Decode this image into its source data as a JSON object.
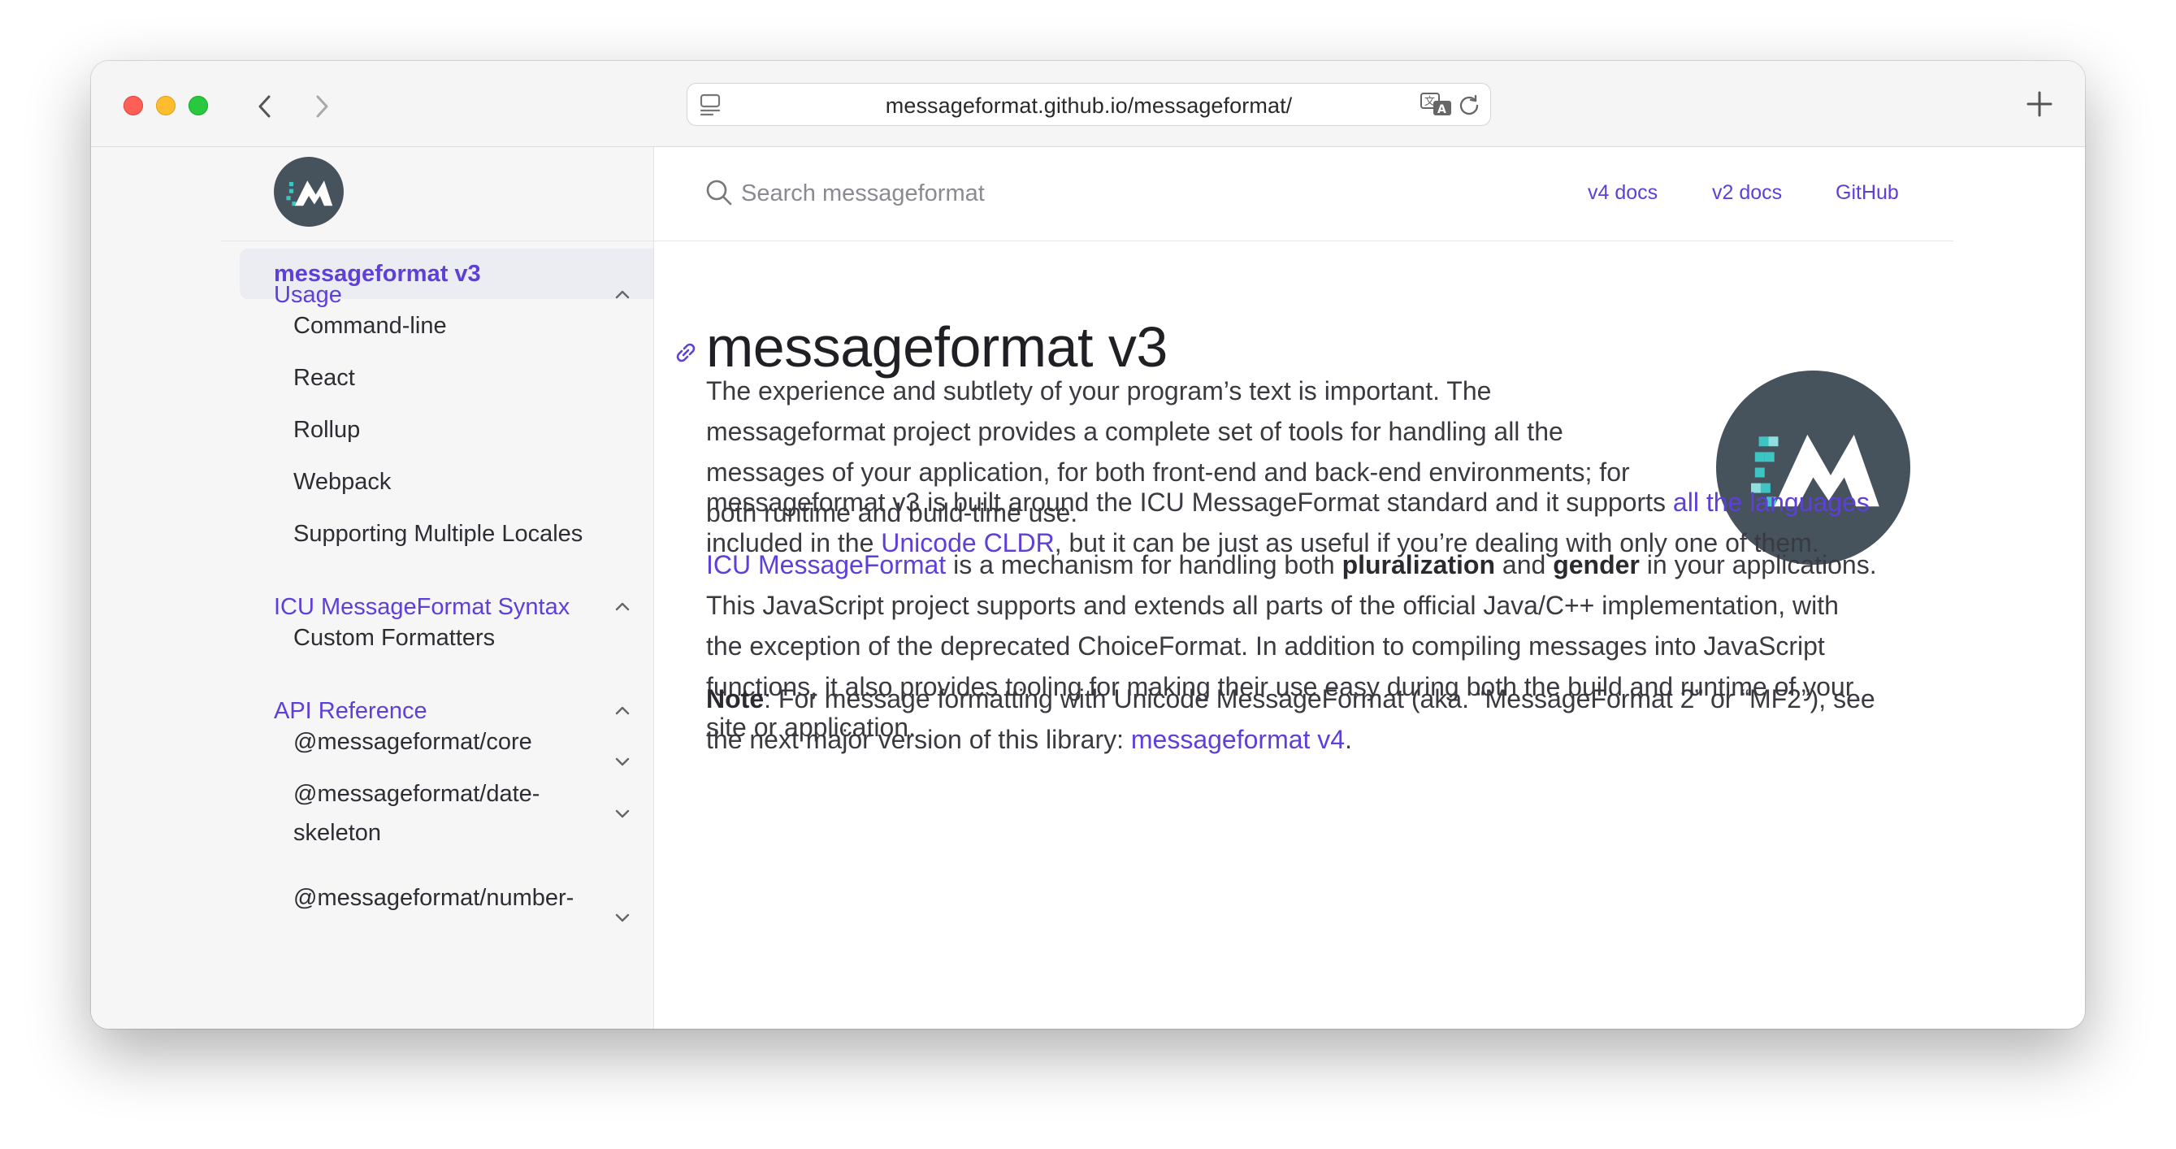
{
  "browser": {
    "url": "messageformat.github.io/messageformat/"
  },
  "header": {
    "search_placeholder": "Search messageformat",
    "links": [
      "v4 docs",
      "v2 docs",
      "GitHub"
    ]
  },
  "sidebar": {
    "active": "messageformat v3",
    "usage": {
      "label": "Usage",
      "items": [
        "Command-line",
        "React",
        "Rollup",
        "Webpack",
        "Supporting Multiple Locales"
      ]
    },
    "syntax": {
      "label": "ICU MessageFormat Syntax",
      "items": [
        "Custom Formatters"
      ]
    },
    "api": {
      "label": "API Reference",
      "items": [
        {
          "line1": "@messageformat/core",
          "line2": ""
        },
        {
          "line1": "@messageformat/date-",
          "line2": "skeleton"
        },
        {
          "line1": "@messageformat/number-",
          "line2": ""
        }
      ]
    }
  },
  "main": {
    "title": "messageformat v3",
    "p1": {
      "lines": [
        "The experience and subtlety of your program’s text is important. The",
        "messageformat project provides a complete set of tools for handling all the",
        "messages of your application, for both front-end and back-end environments; for",
        "both runtime and build-time use."
      ]
    },
    "p2": {
      "l1_text": "messageformat v3 is built around the ICU MessageFormat standard and it supports ",
      "l1_link": "all the languages",
      "l2_text_a": "included in the ",
      "l2_link": "Unicode CLDR",
      "l2_text_b": ", but it can be just as useful if you’re dealing with only one of them."
    },
    "p3": {
      "link": "ICU MessageFormat",
      "t1": " is a mechanism for handling both ",
      "b1": "pluralization",
      "t2": " and ",
      "b2": "gender",
      "t3": " in your applications.",
      "lines": [
        "This JavaScript project supports and extends all parts of the official Java/C++ implementation, with",
        "the exception of the deprecated ChoiceFormat. In addition to compiling messages into JavaScript",
        "functions, it also provides tooling for making their use easy during both the build and runtime of your",
        "site or application."
      ]
    },
    "note": {
      "label": "Note",
      "t1": ": For message formatting with Unicode MessageFormat (aka. “MessageFormat 2” or “MF2”), see",
      "t2": "the next major version of this library: ",
      "link": "messageformat v4",
      "t3": "."
    }
  }
}
